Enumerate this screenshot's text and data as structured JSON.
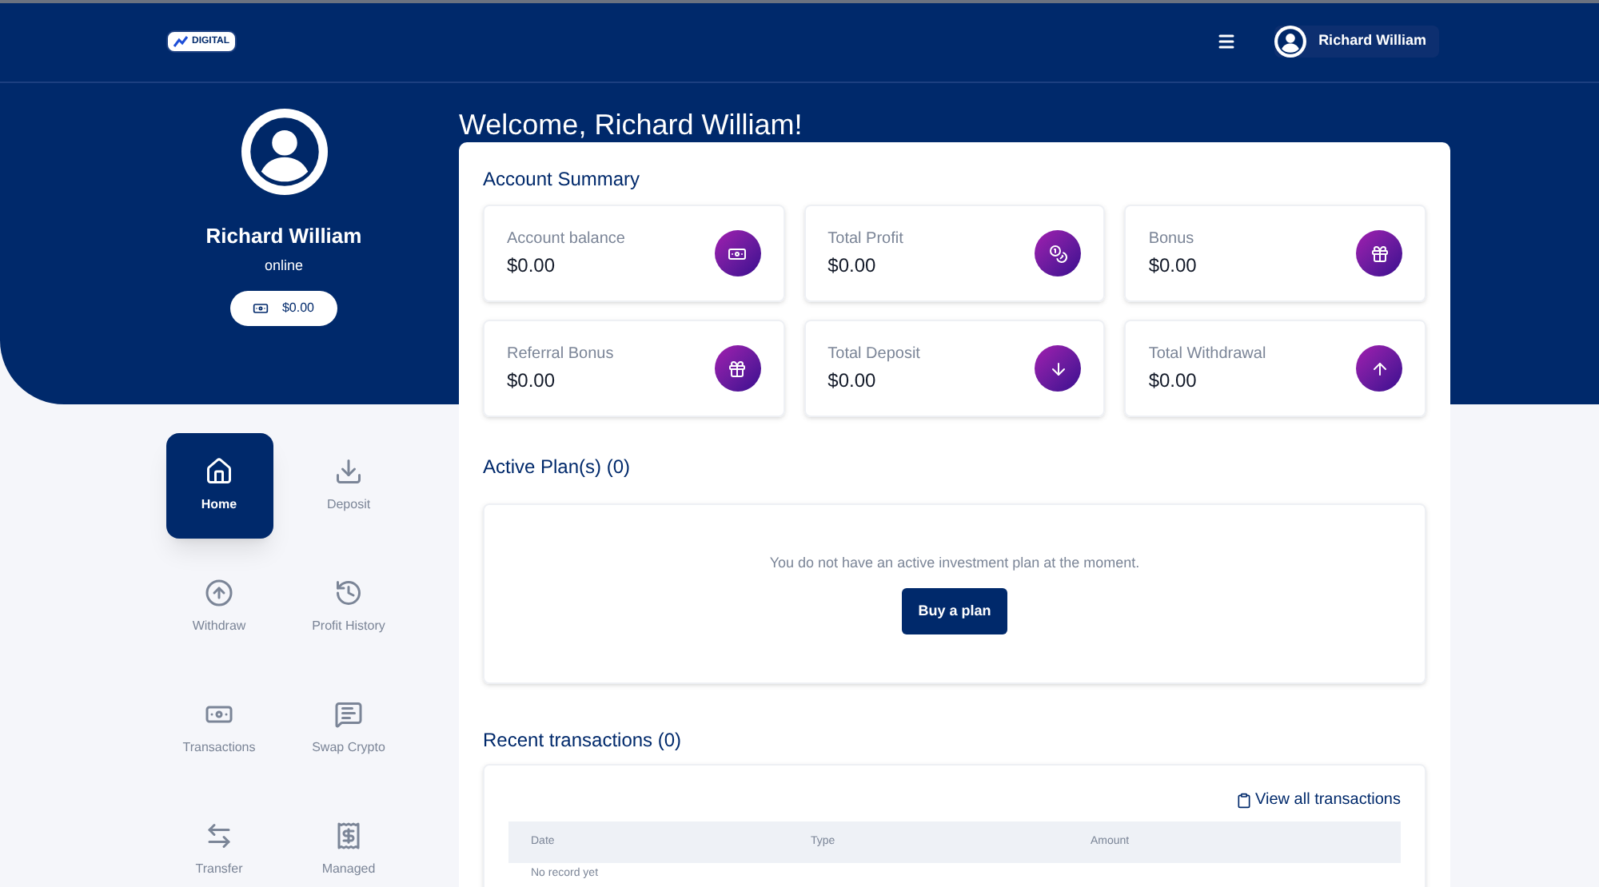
{
  "logo": {
    "text": "DIGITAL"
  },
  "topbar": {
    "user_name": "Richard William"
  },
  "profile": {
    "name": "Richard William",
    "status": "online",
    "balance": "$0.00"
  },
  "nav": [
    {
      "label": "Home",
      "selected": true
    },
    {
      "label": "Deposit",
      "selected": false
    },
    {
      "label": "Withdraw",
      "selected": false
    },
    {
      "label": "Profit History",
      "selected": false
    },
    {
      "label": "Transactions",
      "selected": false
    },
    {
      "label": "Swap Crypto",
      "selected": false
    },
    {
      "label": "Transfer",
      "selected": false
    },
    {
      "label": "Managed",
      "selected": false
    }
  ],
  "welcome": "Welcome, Richard William!",
  "summary": {
    "title": "Account Summary",
    "cards": [
      {
        "label": "Account balance",
        "value": "$0.00"
      },
      {
        "label": "Total Profit",
        "value": "$0.00"
      },
      {
        "label": "Bonus",
        "value": "$0.00"
      },
      {
        "label": "Referral Bonus",
        "value": "$0.00"
      },
      {
        "label": "Total Deposit",
        "value": "$0.00"
      },
      {
        "label": "Total Withdrawal",
        "value": "$0.00"
      }
    ]
  },
  "plans": {
    "title": "Active Plan(s) (0)",
    "message": "You do not have an active investment plan at the moment.",
    "button": "Buy a plan"
  },
  "transactions": {
    "title": "Recent transactions (0)",
    "link": "View all transactions",
    "columns": [
      "Date",
      "Type",
      "Amount"
    ],
    "empty": "No record yet"
  }
}
